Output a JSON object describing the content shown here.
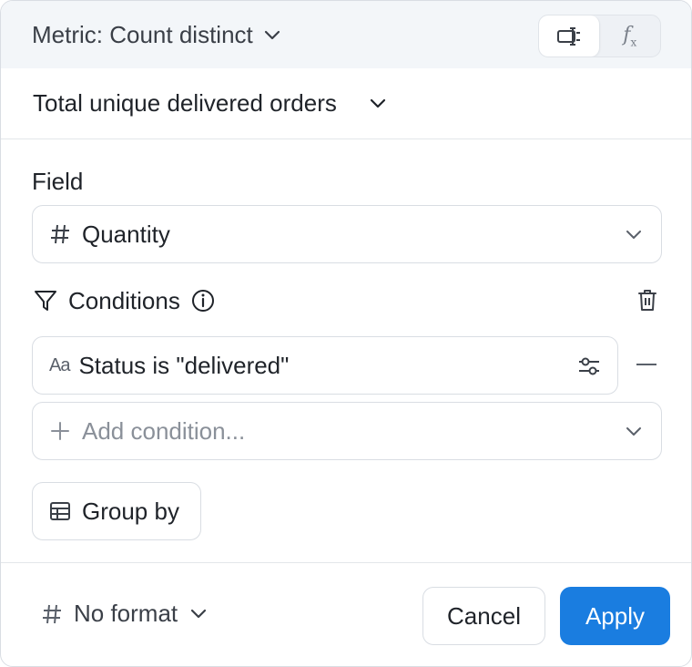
{
  "header": {
    "metric_type_label": "Metric: Count distinct",
    "mode_toggle": [
      {
        "icon": "column-picker-icon",
        "active": true
      },
      {
        "icon": "function-icon",
        "glyph": "f",
        "glyph_sub": "x",
        "active": false
      }
    ]
  },
  "metric_name": "Total unique delivered orders",
  "field": {
    "label": "Field",
    "value": "Quantity",
    "icon": "hash-icon"
  },
  "conditions": {
    "label": "Conditions",
    "items": [
      {
        "type_icon_text": "Aa",
        "text": "Status is \"delivered\""
      }
    ],
    "add_placeholder": "Add condition..."
  },
  "group_by_label": "Group by",
  "footer": {
    "format_label": "No format",
    "cancel_label": "Cancel",
    "apply_label": "Apply"
  },
  "colors": {
    "accent": "#1a7de0",
    "header_bg": "#f3f6f9",
    "border": "#d9dde3",
    "text": "#1f2329",
    "muted": "#8a9099"
  }
}
